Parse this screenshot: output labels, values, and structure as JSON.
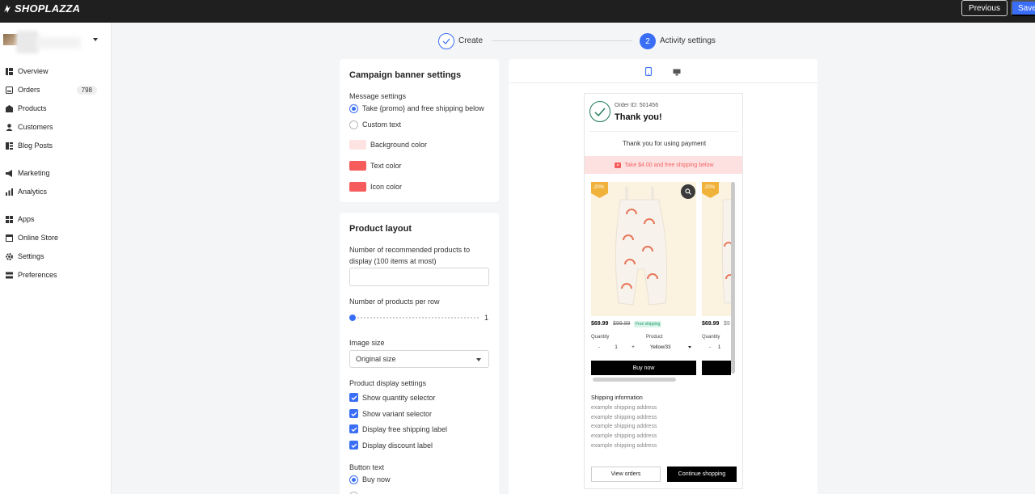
{
  "brand": {
    "logo_text": "SHOPLAZZA"
  },
  "header": {
    "previous_label": "Previous",
    "save_label": "Save"
  },
  "sidebar": {
    "items": [
      {
        "label": "Overview",
        "icon": "overview-icon"
      },
      {
        "label": "Orders",
        "icon": "orders-icon",
        "count": "798"
      },
      {
        "label": "Products",
        "icon": "products-icon"
      },
      {
        "label": "Customers",
        "icon": "customers-icon"
      },
      {
        "label": "Blog Posts",
        "icon": "blog-icon"
      },
      {
        "label": "Marketing",
        "icon": "marketing-icon"
      },
      {
        "label": "Analytics",
        "icon": "analytics-icon"
      },
      {
        "label": "Apps",
        "icon": "apps-icon"
      },
      {
        "label": "Online Store",
        "icon": "store-icon"
      },
      {
        "label": "Settings",
        "icon": "gear-icon"
      },
      {
        "label": "Preferences",
        "icon": "preferences-icon"
      }
    ]
  },
  "steps": {
    "step1_label": "Create",
    "step2_number": "2",
    "step2_label": "Activity settings"
  },
  "banner_settings": {
    "title": "Campaign banner settings",
    "message_label": "Message settings",
    "option_promo": "Take {promo} and free shipping below",
    "option_custom": "Custom text",
    "background_color_label": "Background color",
    "text_color_label": "Text color",
    "icon_color_label": "Icon color",
    "background_color": "#fde3e1",
    "text_color": "#f75c5c",
    "icon_color": "#f75c5c"
  },
  "product_layout": {
    "title": "Product layout",
    "recommended_label_line1": "Number of recommended products to",
    "recommended_label_line2": "display (100 items at most)",
    "recommended_value": "",
    "per_row_label": "Number of products per row",
    "per_row_value": "1",
    "image_size_label": "Image size",
    "image_size_value": "Original size",
    "display_settings_label": "Product display settings",
    "checks": [
      "Show quantity selector",
      "Show variant selector",
      "Display free shipping label",
      "Display discount label"
    ],
    "button_text_label": "Button text",
    "button_option_buy": "Buy now"
  },
  "preview": {
    "order_id": "Order ID: 501456",
    "thanks": "Thank you!",
    "thanks_message": "Thank you for using payment",
    "promo_text": "Take $4.00 and free shipping below",
    "discount_badge": "-20%",
    "price": "$69.99",
    "old_price": "$99.99",
    "free_label": "Free shipping",
    "quantity_label": "Quantity",
    "product_label": "Product",
    "quantity_value": "1",
    "minus": "-",
    "plus": "+",
    "variant_value": "Yellow/33",
    "buy_now": "Buy now",
    "shipping_title": "Shipping information",
    "shipping_lines": [
      "example shipping address",
      "example shipping address",
      "example shipping address",
      "example shipping address",
      "example shipping address"
    ],
    "view_orders": "View orders",
    "continue_shopping": "Continue shopping",
    "second_badge": "-20%",
    "second_price": "$69.99",
    "second_old_price": "$9",
    "second_quantity_label": "Quantity",
    "second_minus": "-",
    "second_qty": "1"
  },
  "colors": {
    "accent": "#3b6ef6",
    "success": "#1e7b55",
    "badge": "#f0b23b"
  }
}
